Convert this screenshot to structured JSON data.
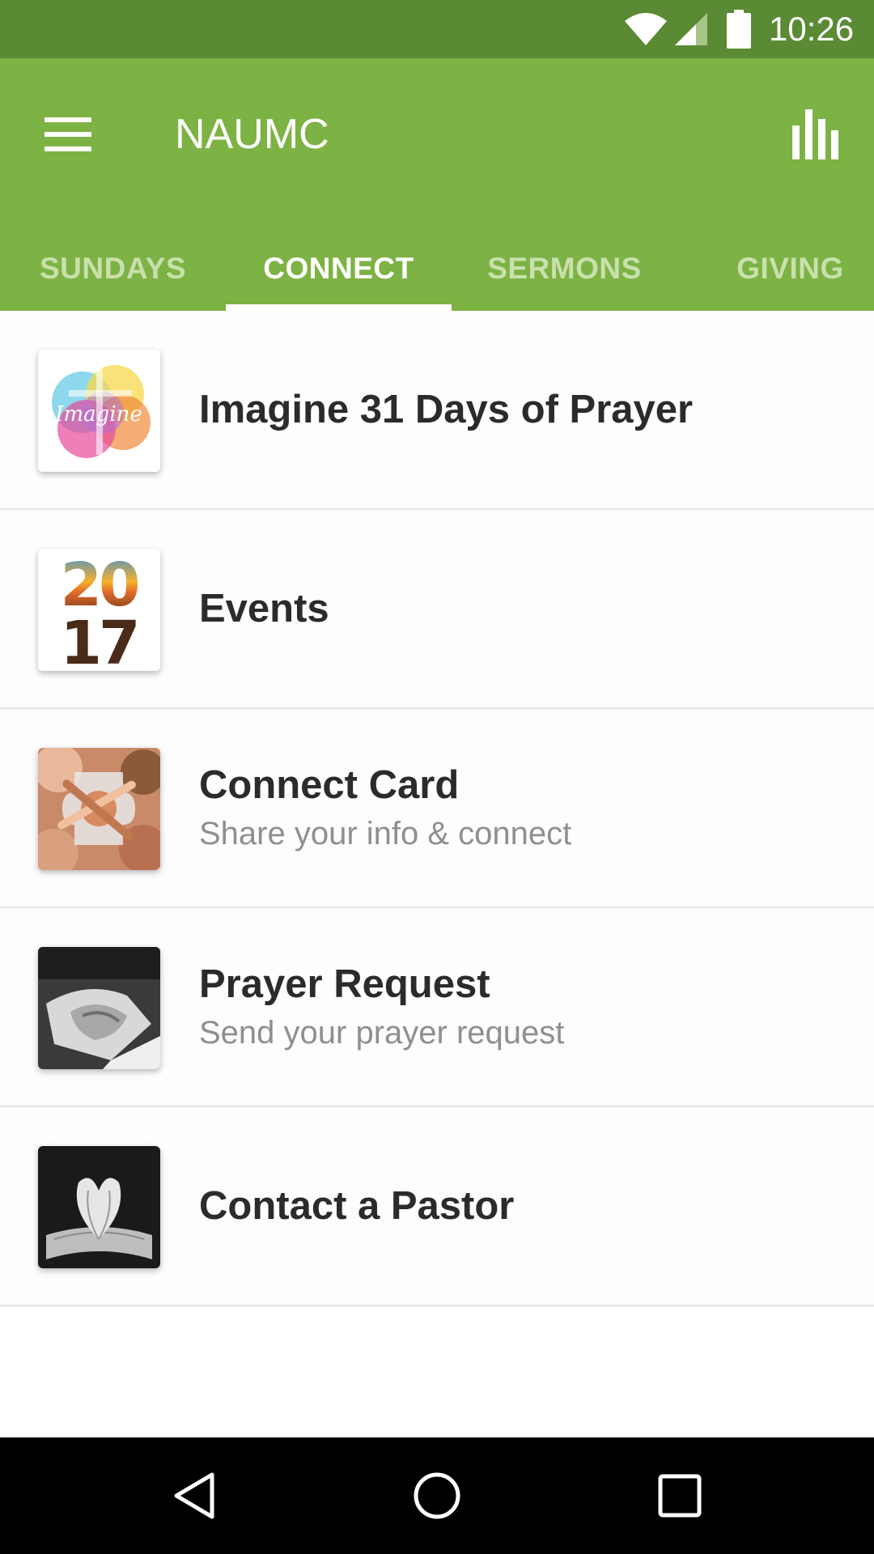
{
  "status_bar": {
    "time": "10:26",
    "icons": [
      "wifi-icon",
      "cell-signal-icon",
      "battery-icon"
    ],
    "color": "#5a8a33"
  },
  "app_bar": {
    "title": "NAUMC",
    "menu_icon": "hamburger-menu-icon",
    "stats_icon": "bar-chart-icon",
    "color": "#7db244"
  },
  "tabs": [
    {
      "label": "SUNDAYS",
      "active": false
    },
    {
      "label": "CONNECT",
      "active": true
    },
    {
      "label": "SERMONS",
      "active": false
    },
    {
      "label": "GIVING",
      "active": false
    }
  ],
  "list": {
    "items": [
      {
        "title": "Imagine 31 Days of Prayer",
        "subtitle": "",
        "thumbnail": "imagine-watercolor-thumbnail",
        "thumbnail_text": "Imagine"
      },
      {
        "title": "Events",
        "subtitle": "",
        "thumbnail": "2017-calendar-thumbnail",
        "thumbnail_text": "2017"
      },
      {
        "title": "Connect Card",
        "subtitle": "Share your info & connect",
        "thumbnail": "puzzle-hands-thumbnail"
      },
      {
        "title": "Prayer Request",
        "subtitle": "Send your prayer request",
        "thumbnail": "praying-hands-thumbnail"
      },
      {
        "title": "Contact a Pastor",
        "subtitle": "",
        "thumbnail": "book-heart-thumbnail"
      }
    ]
  },
  "nav_bar": {
    "icons": [
      "back-icon",
      "home-icon",
      "recents-icon"
    ]
  }
}
